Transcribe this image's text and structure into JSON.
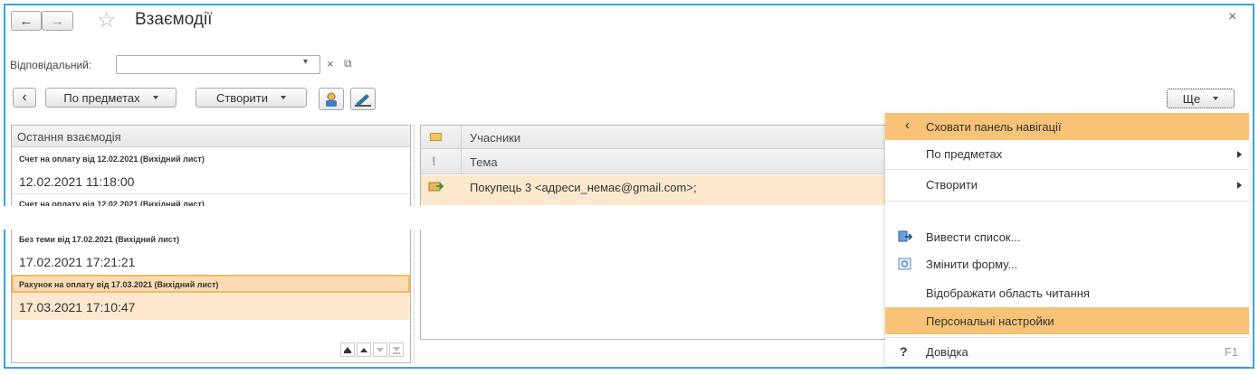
{
  "window": {
    "title": "Взаємодії",
    "close_glyph": "×"
  },
  "nav": {
    "back_glyph": "←",
    "forward_glyph": "→",
    "star_glyph": "☆"
  },
  "filter": {
    "label": "Відповідальний:",
    "value": "",
    "dropdown_glyph": "▾",
    "clear_glyph": "×",
    "open_glyph": "⧉"
  },
  "toolbar": {
    "nav_toggle_glyph": "‹",
    "by_subjects_label": "По предметах",
    "create_label": "Створити",
    "more_label": "Ще"
  },
  "left_list": {
    "header": "Остання взаємодія",
    "items": [
      {
        "title": "Счет на оплату від 12.02.2021 (Вихідний лист)",
        "date": "12.02.2021 11:18:00",
        "selected": false
      },
      {
        "title": "Счет на оплату від 12.02.2021 (Вихідний лист)",
        "date": "",
        "selected": false
      },
      {
        "title": "Без теми від 17.02.2021 (Вихідний лист)",
        "date": "17.02.2021 17:21:21",
        "selected": false
      },
      {
        "title": "Рахунок на оплату від 17.03.2021 (Вихідний лист)",
        "date": "17.03.2021 17:10:47",
        "selected": true
      }
    ]
  },
  "right_list": {
    "header_participants": "Учасники",
    "header_subject": "Тема",
    "row_participants": "Покупець 3 <адреси_немає@gmail.com>;"
  },
  "more_menu": {
    "items": [
      {
        "label": "Сховати панель навігації",
        "icon": "chevron-left-icon",
        "highlighted": true,
        "submenu": false
      },
      {
        "label": "По предметах",
        "highlighted": false,
        "submenu": true
      },
      {
        "label": "Створити",
        "highlighted": false,
        "submenu": true
      },
      {
        "label": "Вивести список...",
        "icon": "list-export-icon",
        "highlighted": false,
        "submenu": false
      },
      {
        "label": "Змінити форму...",
        "icon": "form-settings-icon",
        "highlighted": false,
        "submenu": false
      },
      {
        "label": "Відображати область читання",
        "highlighted": false,
        "submenu": false
      },
      {
        "label": "Персональні настройки",
        "highlighted": true,
        "submenu": false
      },
      {
        "label": "Довідка",
        "icon": "help-icon",
        "shortcut": "F1",
        "highlighted": false,
        "submenu": false
      }
    ]
  },
  "colors": {
    "accent_border": "#39a3e0",
    "highlight": "#f8c277",
    "selected_row": "#fde8cf"
  }
}
